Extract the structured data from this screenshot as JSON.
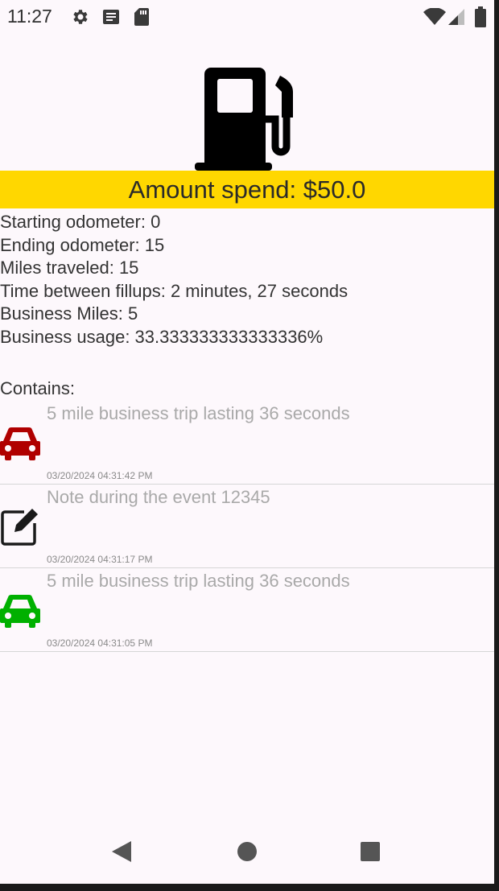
{
  "status_bar": {
    "time": "11:27",
    "left_icons": [
      "gear-icon",
      "notification-list-icon",
      "sd-card-icon"
    ],
    "right_icons": [
      "wifi-icon",
      "cell-signal-icon",
      "battery-icon"
    ]
  },
  "header": {
    "icon": "gas-pump-icon",
    "amount_text": "Amount spend: $50.0",
    "accent_color": "#ffd700"
  },
  "stats": [
    "Starting odometer: 0",
    "Ending odometer: 15",
    "Miles traveled: 15",
    "Time between fillups: 2 minutes, 27 seconds",
    "Business Miles: 5",
    "Business usage: 33.333333333333336%"
  ],
  "contains_label": "Contains:",
  "events": [
    {
      "icon": "car-icon",
      "icon_color": "#b00000",
      "title": "5 mile business trip lasting 36 seconds",
      "timestamp": "03/20/2024 04:31:42 PM"
    },
    {
      "icon": "edit-note-icon",
      "icon_color": "#1a1a1a",
      "title": "Note during the event 12345",
      "timestamp": "03/20/2024 04:31:17 PM"
    },
    {
      "icon": "car-icon",
      "icon_color": "#00b000",
      "title": "5 mile business trip lasting 36 seconds",
      "timestamp": "03/20/2024 04:31:05 PM"
    }
  ],
  "nav_bar": {
    "buttons": [
      "back-icon",
      "home-icon",
      "recents-icon"
    ]
  }
}
